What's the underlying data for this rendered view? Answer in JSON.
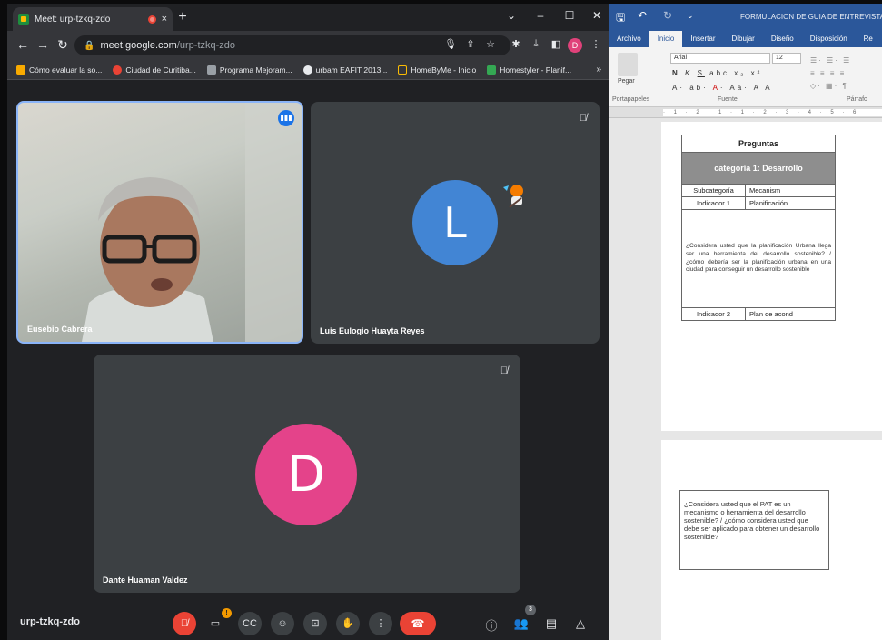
{
  "browser": {
    "tab_title": "Meet: urp-tzkq-zdo",
    "tab_close": "×",
    "new_tab": "+",
    "window_controls": [
      "⌄",
      "–",
      "☐",
      "✕"
    ],
    "url_domain": "meet.google.com",
    "url_path": "/urp-tzkq-zdo",
    "profile_initial": "D",
    "bookmarks": [
      {
        "label": "Cómo evaluar la so...",
        "color": "#f9ab00"
      },
      {
        "label": "Ciudad de Curitiba...",
        "color": "#ea4335"
      },
      {
        "label": "Programa Mejoram...",
        "color": "#9aa0a6"
      },
      {
        "label": "urbam EAFIT 2013...",
        "color": "#e8eaed"
      },
      {
        "label": "HomeByMe - Inicio",
        "color": "#fbbc04"
      },
      {
        "label": "Homestyler - Planif...",
        "color": "#34a853"
      }
    ],
    "bookmarks_more": "»"
  },
  "meet": {
    "participants": [
      {
        "name": "Eusebio Cabrera"
      },
      {
        "name": "Luis Eulogio Huayta Reyes",
        "initial": "L",
        "avatar_color": "#4285d4"
      },
      {
        "name": "Dante Huaman Valdez",
        "initial": "D",
        "avatar_color": "#e4438a"
      }
    ],
    "meeting_code": "urp-tzkq-zdo",
    "people_count": "3",
    "notification_badge": "!"
  },
  "word": {
    "doc_title": "FORMULACION DE GUIA DE ENTREVISTA -D",
    "menu": [
      "Archivo",
      "Inicio",
      "Insertar",
      "Dibujar",
      "Diseño",
      "Disposición",
      "Re"
    ],
    "active_menu": "Inicio",
    "font_name": "Arial",
    "font_size": "12",
    "ribbon_groups": {
      "clipboard": "Portapapeles",
      "font": "Fuente",
      "paragraph": "Párrafo",
      "paste": "Pegar"
    },
    "table": {
      "header": "Preguntas",
      "category": "categoría 1: Desarrollo",
      "subcategory_label": "Subcategoría",
      "subcategory_value": "Mecanism",
      "indicator1_label": "Indicador 1",
      "indicator1_value": "Planificación",
      "question1": "¿Considera usted que la planificación Urbana llega ser una herramienta del desarrollo sostenible? / ¿cómo debería ser la planificación urbana en una ciudad para conseguir un desarrollo sostenible",
      "indicator2_label": "Indicador 2",
      "indicator2_value": "Plan de acond"
    },
    "question2": "¿Considera usted que el PAT es un mecanismo o herramienta del desarrollo sostenible? / ¿cómo considera usted que debe ser aplicado para obtener un desarrollo sostenible?"
  }
}
